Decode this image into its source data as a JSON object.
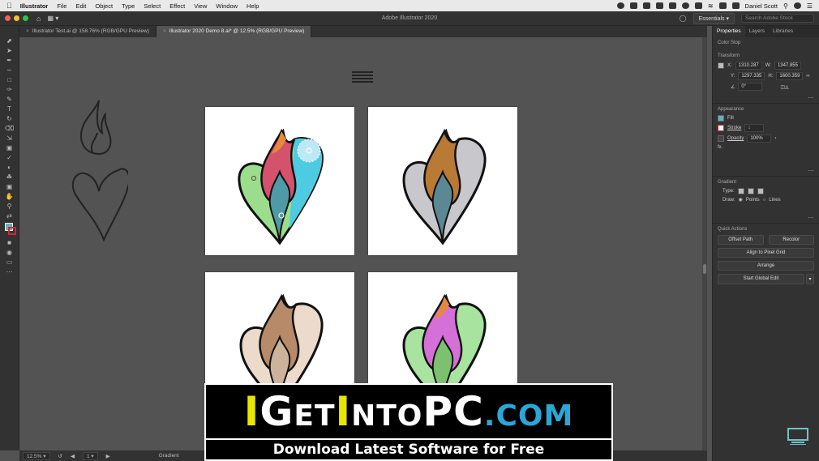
{
  "menubar": {
    "app": "Illustrator",
    "items": [
      "File",
      "Edit",
      "Object",
      "Type",
      "Select",
      "Effect",
      "View",
      "Window",
      "Help"
    ],
    "user": "Daniel Scott"
  },
  "appbar": {
    "title": "Adobe Illustrator 2020",
    "workspace": "Essentials",
    "search_placeholder": "Search Adobe Stock"
  },
  "tabs": [
    {
      "label": "Illustrator Test.ai @ 158.76% (RGB/GPU Preview)"
    },
    {
      "label": "Illustrator 2020 Demo 8.ai* @ 12.5% (RGB/GPU Preview)"
    }
  ],
  "panel": {
    "tabs": [
      "Properties",
      "Layers",
      "Libraries"
    ],
    "color_stop": "Color Stop",
    "transform": {
      "title": "Transform",
      "x": "1310.287",
      "y": "1297.335",
      "w": "1347.855",
      "h": "1600.359",
      "angle": "0°"
    },
    "appearance": {
      "title": "Appearance",
      "fill": "Fill",
      "stroke": "Stroke",
      "opacity": "Opacity",
      "opacity_value": "100%",
      "fx": "fx."
    },
    "gradient": {
      "title": "Gradient",
      "type": "Type:",
      "draw": "Draw:",
      "points": "Points",
      "lines": "Lines"
    },
    "quick_actions": {
      "title": "Quick Actions",
      "offset_path": "Offset Path",
      "recolor": "Recolor",
      "align": "Align to Pixel Grid",
      "arrange": "Arrange",
      "global_edit": "Start Global Edit"
    }
  },
  "statusbar": {
    "zoom": "12.5%",
    "artboard": "1",
    "tool": "Gradient"
  },
  "watermark": {
    "parts": [
      {
        "t": "I",
        "c": "#e6e600"
      },
      {
        "t": "G",
        "c": "#ffffff"
      },
      {
        "t": "ET",
        "c": "#ffffff"
      },
      {
        "t": "I",
        "c": "#e6e600"
      },
      {
        "t": "NTO",
        "c": "#ffffff"
      },
      {
        "t": "PC",
        "c": "#ffffff"
      },
      {
        "t": ".COM",
        "c": "#29a8d8"
      }
    ],
    "tagline": "Download Latest Software for Free"
  },
  "colors": {
    "accent": "#62b5b8",
    "ui_dark": "#323232",
    "canvas": "#535353"
  }
}
